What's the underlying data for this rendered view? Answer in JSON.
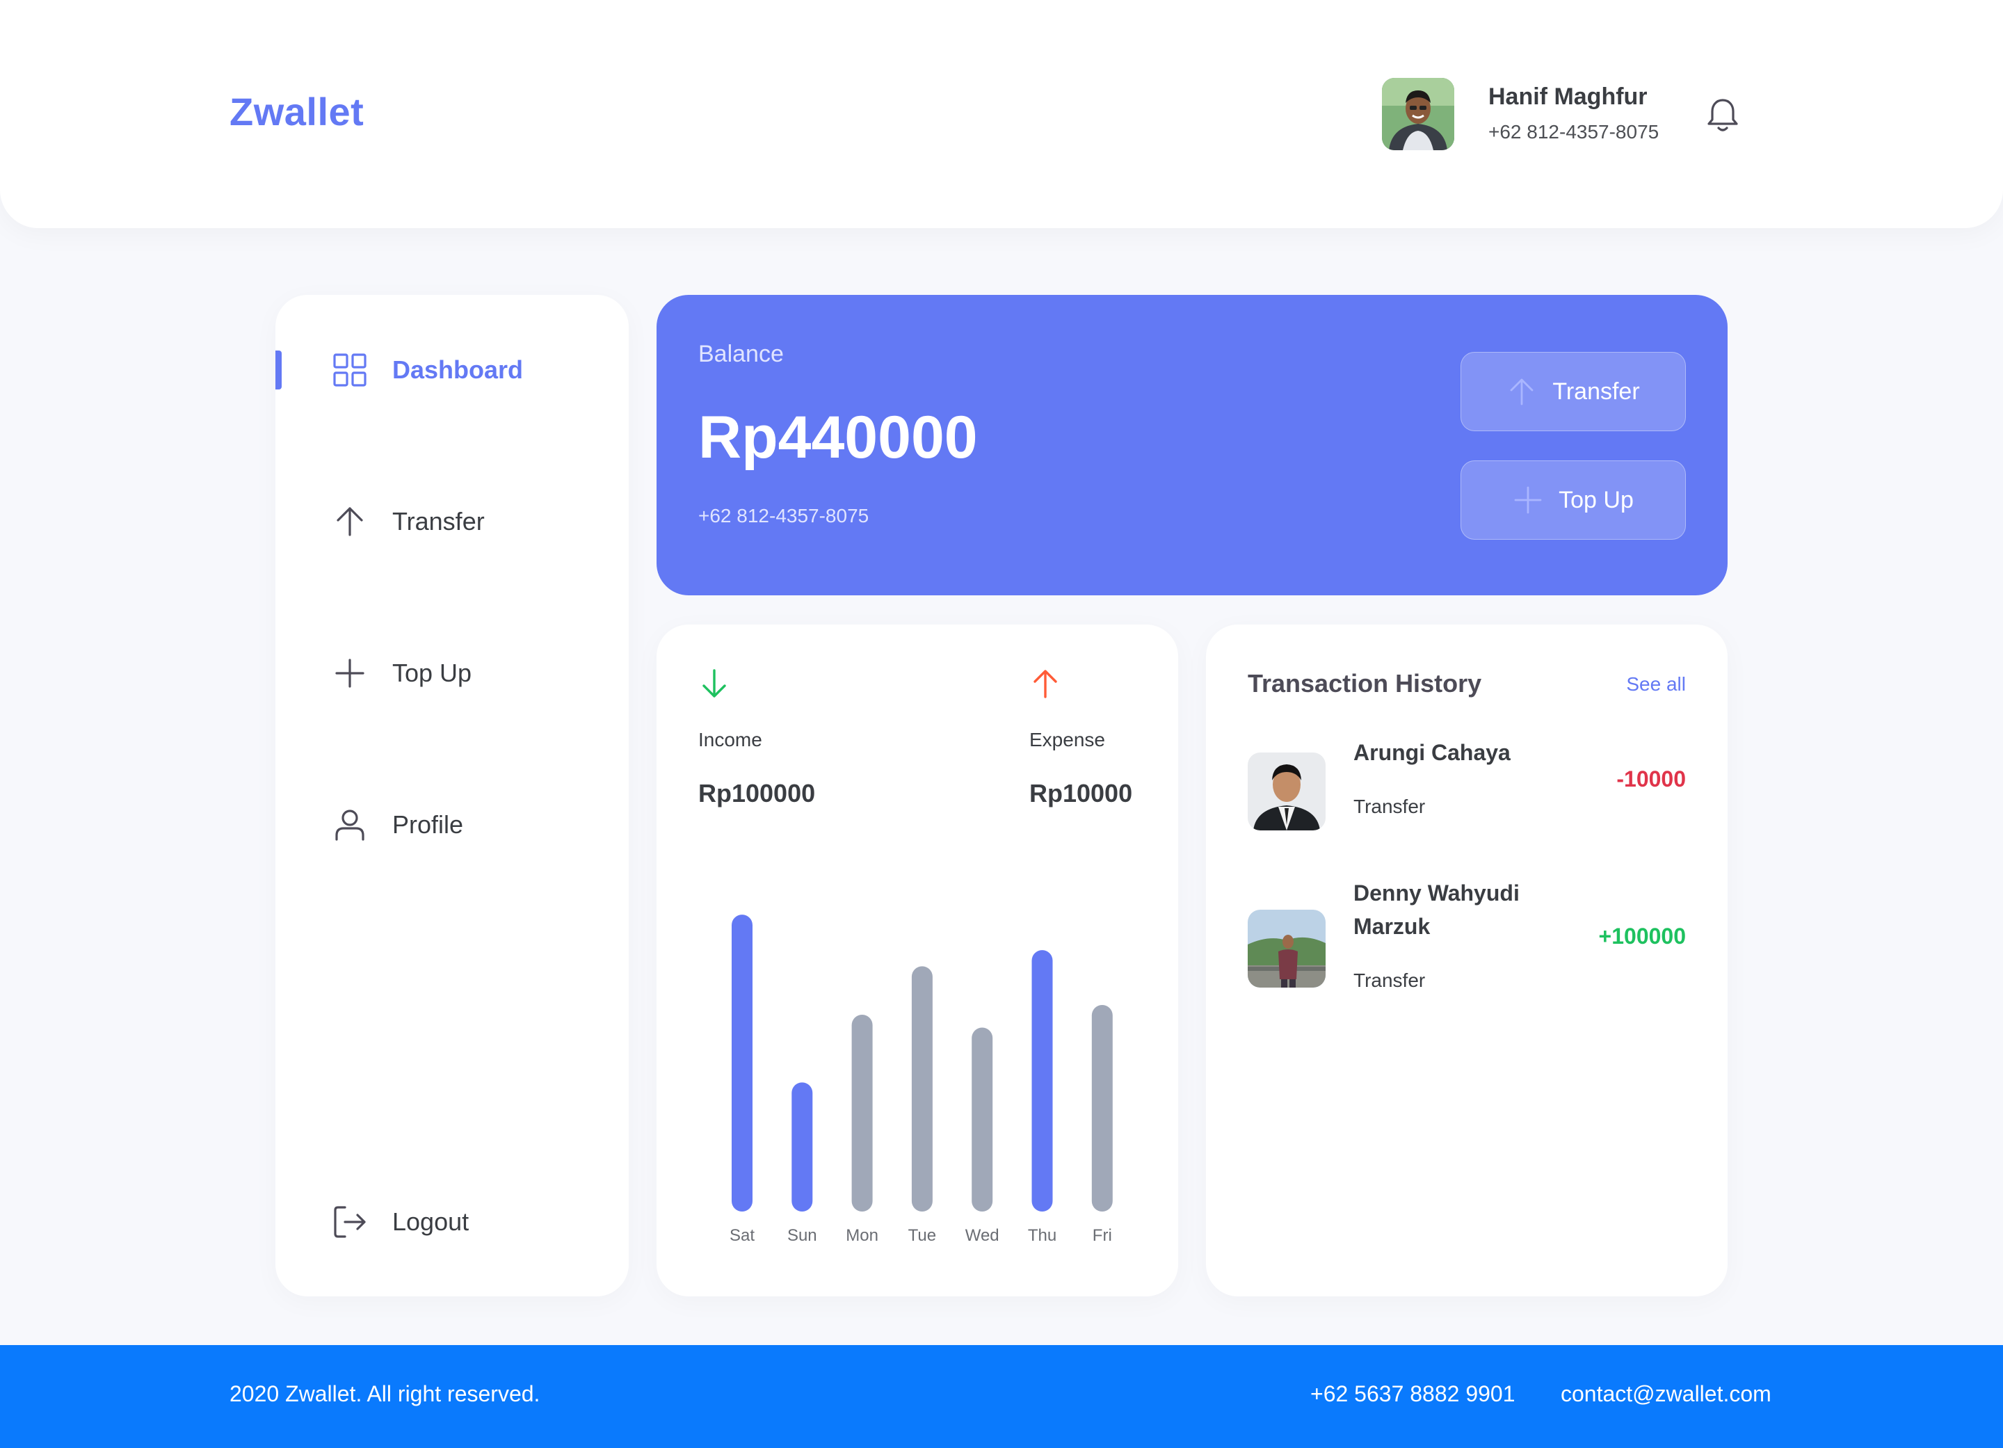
{
  "app": {
    "brand": "Zwallet"
  },
  "user": {
    "name": "Hanif Maghfur",
    "phone": "+62 812-4357-8075"
  },
  "sidebar": {
    "items": [
      {
        "label": "Dashboard",
        "icon": "grid-icon",
        "active": true
      },
      {
        "label": "Transfer",
        "icon": "arrow-up-icon"
      },
      {
        "label": "Top Up",
        "icon": "plus-icon"
      },
      {
        "label": "Profile",
        "icon": "user-icon"
      }
    ],
    "logout": {
      "label": "Logout",
      "icon": "logout-icon"
    }
  },
  "balance": {
    "label": "Balance",
    "amount": "Rp440000",
    "phone": "+62 812-4357-8075",
    "transfer_label": "Transfer",
    "topup_label": "Top Up"
  },
  "stats": {
    "income_label": "Income",
    "income_value": "Rp100000",
    "expense_label": "Expense",
    "expense_value": "Rp10000"
  },
  "chart_data": {
    "type": "bar",
    "categories": [
      "Sat",
      "Sun",
      "Mon",
      "Tue",
      "Wed",
      "Thu",
      "Fri"
    ],
    "values": [
      92,
      40,
      61,
      76,
      57,
      81,
      64
    ],
    "highlighted": [
      true,
      true,
      false,
      false,
      false,
      true,
      false
    ],
    "ylim": [
      0,
      100
    ],
    "grid": false,
    "colors": {
      "highlight": "#6379f4",
      "normal": "#a0a8b8"
    }
  },
  "history": {
    "title": "Transaction History",
    "see_all": "See all",
    "items": [
      {
        "name": "Arungi Cahaya",
        "type": "Transfer",
        "amount": "-10000",
        "direction": "out"
      },
      {
        "name": "Denny Wahyudi Marzuk",
        "type": "Transfer",
        "amount": "+100000",
        "direction": "in"
      }
    ]
  },
  "footer": {
    "copyright": "2020 Zwallet. All right reserved.",
    "phone": "+62 5637 8882 9901",
    "email": "contact@zwallet.com"
  },
  "colors": {
    "primary": "#6379f4",
    "footer": "#0a7afd",
    "income": "#1ec15f",
    "expense": "#ff5b37",
    "negative": "#e0344a",
    "positive": "#1ec15f"
  }
}
